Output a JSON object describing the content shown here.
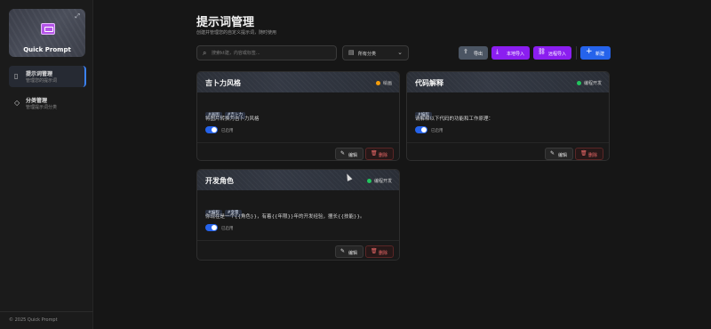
{
  "app": {
    "name": "Quick Prompt",
    "footer": "© 2025 Quick Prompt"
  },
  "sidebar": {
    "items": [
      {
        "title": "提示词管理",
        "subtitle": "管理您的提示词",
        "icon": "clipboard-icon",
        "active": true
      },
      {
        "title": "分类管理",
        "subtitle": "管理提示词分类",
        "icon": "tag-icon",
        "active": false
      }
    ]
  },
  "header": {
    "title": "提示词管理",
    "subtitle": "创建并管理您的自定义提示词，随时使用"
  },
  "toolbar": {
    "search_placeholder": "搜索kt建，内容或标签...",
    "category_select": "所有分类",
    "export_label": "导出",
    "local_import_label": "本地导入",
    "remote_import_label": "远程导入",
    "new_label": "新建"
  },
  "colors": {
    "accent_blue": "#2563eb",
    "import_purple": "#8b1ef0",
    "status_orange": "#f59e0b",
    "status_green": "#22c55e",
    "delete_red": "#f06a6a"
  },
  "cards": [
    {
      "title": "吉卜力风格",
      "status": "绘画",
      "status_color": "#f59e0b",
      "tags": [
        "#画图",
        "#吉卜力"
      ],
      "description": "将图片转换为吉卜力风格",
      "toggle_label": "已启用",
      "enabled": true,
      "edit_label": "编辑",
      "delete_label": "删除"
    },
    {
      "title": "代码解释",
      "status": "编程开发",
      "status_color": "#22c55e",
      "tags": [
        "#编程"
      ],
      "description": "请解释以下代码的功能和工作原理：",
      "toggle_label": "已启用",
      "enabled": true,
      "edit_label": "编辑",
      "delete_label": "删除"
    },
    {
      "title": "开发角色",
      "status": "编程开发",
      "status_color": "#22c55e",
      "tags": [
        "#编程",
        "#变量"
      ],
      "description": "你现在是一个{{角色}}，有着{{年限}}年的开发经验，擅长{{技能}}。",
      "toggle_label": "已启用",
      "enabled": true,
      "edit_label": "编辑",
      "delete_label": "删除"
    }
  ]
}
